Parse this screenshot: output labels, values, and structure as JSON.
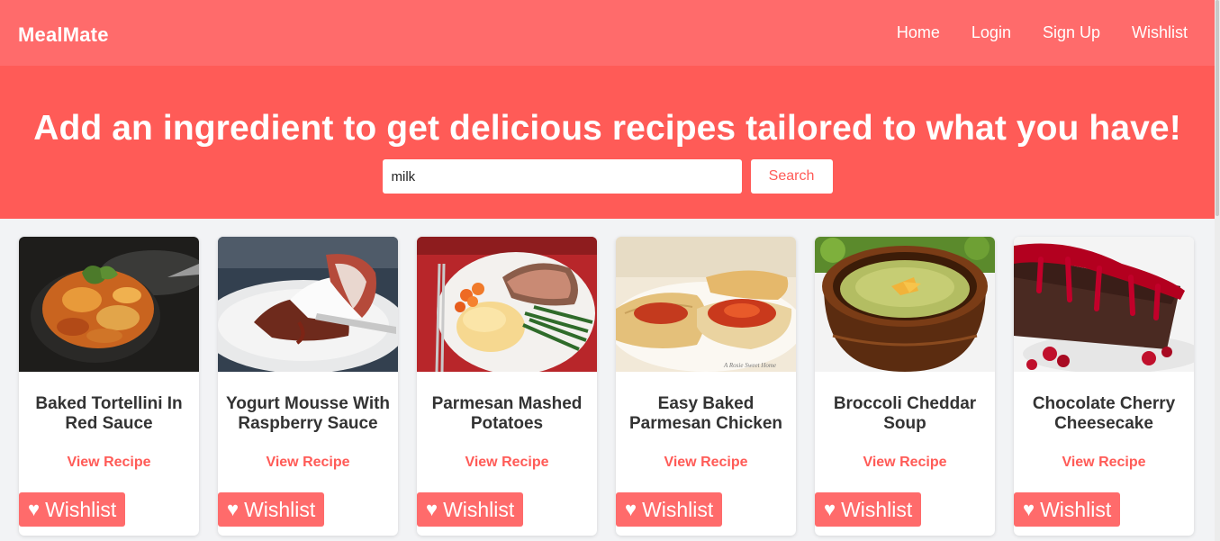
{
  "navbar": {
    "brand": "MealMate",
    "links": [
      {
        "label": "Home"
      },
      {
        "label": "Login"
      },
      {
        "label": "Sign Up"
      },
      {
        "label": "Wishlist"
      }
    ]
  },
  "hero": {
    "title": "Add an ingredient to get delicious recipes tailored to what you have!",
    "search_value": "milk",
    "search_button": "Search"
  },
  "recipes": [
    {
      "title": "Baked Tortellini In Red Sauce",
      "link": "View Recipe",
      "wishlist": "Wishlist",
      "heart": "♥"
    },
    {
      "title": "Yogurt Mousse With Raspberry Sauce",
      "link": "View Recipe",
      "wishlist": "Wishlist",
      "heart": "♥"
    },
    {
      "title": "Parmesan Mashed Potatoes",
      "link": "View Recipe",
      "wishlist": "Wishlist",
      "heart": "♥"
    },
    {
      "title": "Easy Baked Parmesan Chicken",
      "link": "View Recipe",
      "wishlist": "Wishlist",
      "heart": "♥"
    },
    {
      "title": "Broccoli Cheddar Soup",
      "link": "View Recipe",
      "wishlist": "Wishlist",
      "heart": "♥"
    },
    {
      "title": "Chocolate Cherry Cheesecake",
      "link": "View Recipe",
      "wishlist": "Wishlist",
      "heart": "♥"
    }
  ],
  "colors": {
    "navbar": "#ff6b6b",
    "hero": "#ff5b57",
    "accent": "#ff5b57",
    "background": "#f2f3f5"
  }
}
